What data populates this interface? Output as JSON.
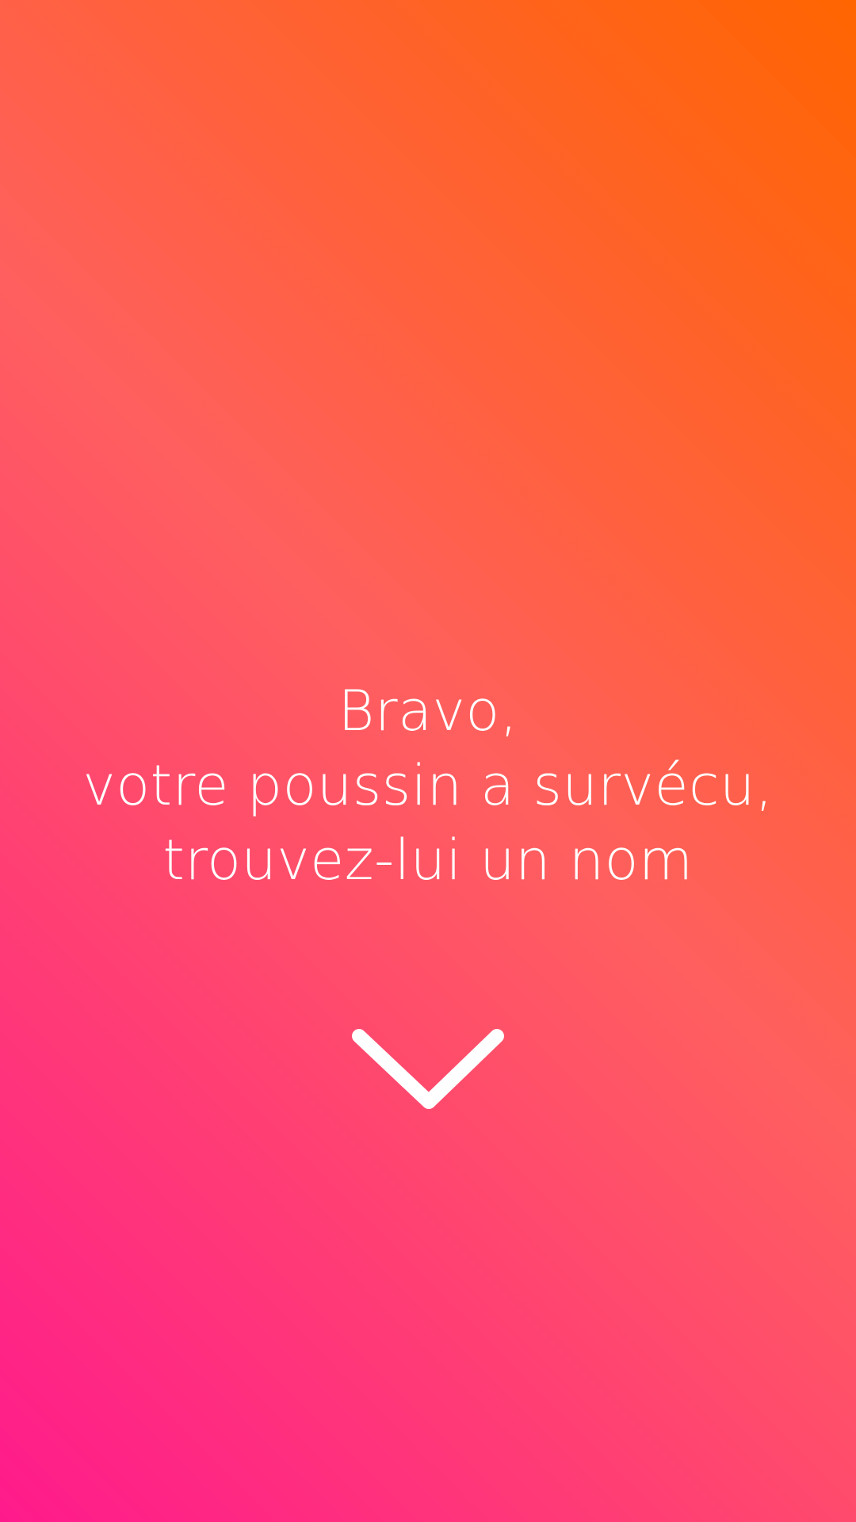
{
  "screen": {
    "background": {
      "top_right_color": "#ff6500",
      "middle_color": "#ff5f5f",
      "bottom_left_color": "#ff1a8c"
    },
    "text_color": "#ffffff"
  },
  "message": {
    "line1": "Bravo,",
    "line2": "votre poussin a survécu,",
    "line3": "trouvez-lui un nom"
  },
  "scroll_button": {
    "icon": "chevron-down-icon"
  }
}
